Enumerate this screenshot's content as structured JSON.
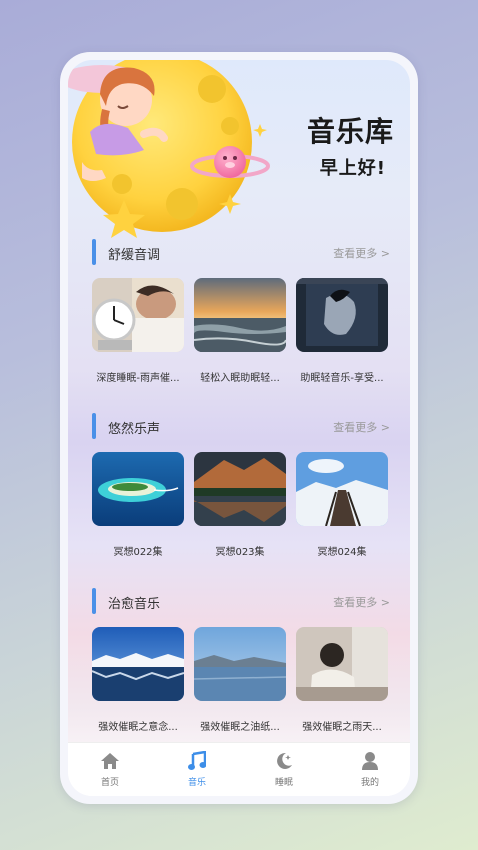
{
  "header": {
    "title": "音乐库",
    "greeting": "早上好!"
  },
  "sections": [
    {
      "title": "舒缓音调",
      "more": "查看更多 >",
      "items": [
        {
          "caption": "深度睡眠-雨声催..."
        },
        {
          "caption": "轻松入眠助眠轻..."
        },
        {
          "caption": "助眠轻音乐-享受..."
        }
      ]
    },
    {
      "title": "悠然乐声",
      "more": "查看更多 >",
      "items": [
        {
          "caption": "冥想022集"
        },
        {
          "caption": "冥想023集"
        },
        {
          "caption": "冥想024集"
        }
      ]
    },
    {
      "title": "治愈音乐",
      "more": "查看更多 >",
      "items": [
        {
          "caption": "强效催眠之意念..."
        },
        {
          "caption": "强效催眠之油纸..."
        },
        {
          "caption": "强效催眠之雨天..."
        }
      ]
    }
  ],
  "tabbar": {
    "items": [
      {
        "label": "首页",
        "icon": "home-icon",
        "active": false
      },
      {
        "label": "音乐",
        "icon": "music-note-icon",
        "active": true
      },
      {
        "label": "睡眠",
        "icon": "moon-icon",
        "active": false
      },
      {
        "label": "我的",
        "icon": "user-icon",
        "active": false
      }
    ]
  },
  "colors": {
    "accent": "#4a90e8",
    "active_tab": "#3d8ee8"
  }
}
